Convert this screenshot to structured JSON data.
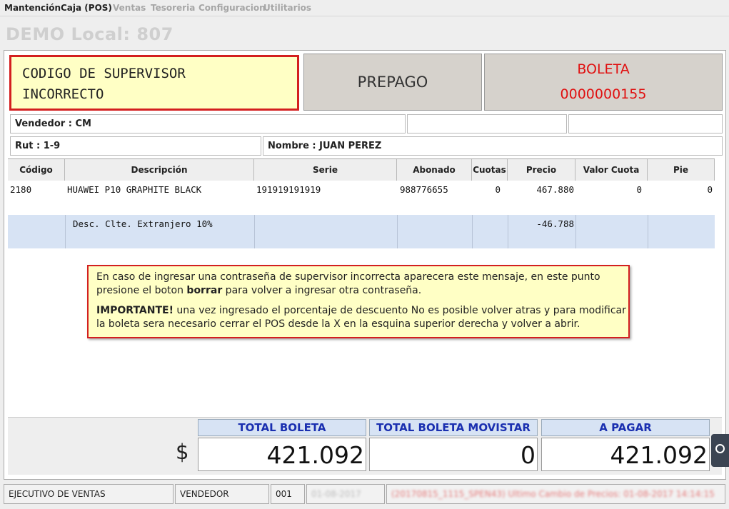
{
  "menu": {
    "items": [
      "Mantención",
      "Caja (POS)",
      "Ventas",
      "Tesoreria",
      "Configuracion",
      "Utilitarios"
    ]
  },
  "window_title": "DEMO Local: 807",
  "error_box": {
    "line1": "CODIGO DE SUPERVISOR",
    "line2": "INCORRECTO"
  },
  "prepago_label": "PREPAGO",
  "boleta": {
    "label": "BOLETA",
    "number": "0000000155"
  },
  "vendedor": "Vendedor : CM",
  "rut": "Rut : 1-9",
  "nombre": "Nombre : JUAN PEREZ",
  "table": {
    "headers": [
      "Código",
      "Descripción",
      "Serie",
      "Abonado",
      "Cuotas",
      "Precio",
      "Valor Cuota",
      "Pie"
    ],
    "rows": [
      {
        "codigo": "2180",
        "descripcion": "HUAWEI P10 GRAPHITE BLACK",
        "serie": "191919191919",
        "abonado": "988776655",
        "cuotas": "0",
        "precio": "467.880",
        "valor_cuota": "0",
        "pie": "0"
      },
      {
        "codigo": "",
        "descripcion": "Desc. Clte. Extranjero 10%",
        "serie": "",
        "abonado": "",
        "cuotas": "",
        "precio": "-46.788",
        "valor_cuota": "",
        "pie": ""
      }
    ]
  },
  "note": {
    "p1_a": "En caso de ingresar una contraseña de supervisor incorrecta aparecera este mensaje, en este punto presione el boton ",
    "p1_bold": "borrar",
    "p1_b": " para volver a ingresar otra contraseña.",
    "p2_bold": "IMPORTANTE!",
    "p2": " una vez ingresado el porcentaje de descuento No es posible volver atras y para modificar la boleta sera necesario cerrar el POS desde la X en la esquina superior derecha y volver a abrir."
  },
  "totals": {
    "currency_symbol": "$",
    "total_boleta_label": "TOTAL BOLETA",
    "total_boleta_value": "421.092",
    "total_movistar_label": "TOTAL BOLETA MOVISTAR",
    "total_movistar_value": "0",
    "a_pagar_label": "A PAGAR",
    "a_pagar_value": "421.092"
  },
  "status": {
    "ejecutivo": "EJECUTIVO DE VENTAS",
    "vendedor": "VENDEDOR",
    "code": "001",
    "date": "01-08-2017",
    "message": "(20170815_1115_SPEN43) Ultimo Cambio de Precios: 01-08-2017 14:14:15"
  },
  "colors": {
    "error_border": "#d31f1f",
    "header_blue": "#1a2fb0",
    "boleta_red": "#e01010",
    "row_highlight": "#d7e3f4"
  },
  "icons": {
    "side_tab": "teamviewer-icon"
  }
}
